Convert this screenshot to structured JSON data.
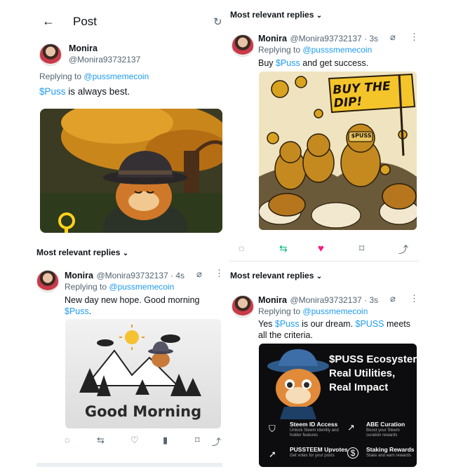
{
  "left_top": {
    "header_title": "Post",
    "name": "Monira",
    "handle": "@Monira93732137",
    "replying_prefix": "Replying to",
    "replying_to": "@pussmemecoin",
    "tweet_cashtag": "$Puss",
    "tweet_rest": " is always best."
  },
  "left_bottom": {
    "section_label": "Most relevant replies",
    "name": "Monira",
    "handle_time": "@Monira93732137 · 4s",
    "replying_prefix": "Replying to",
    "replying_to": "@pussmemecoin",
    "line1": "New day new hope. Good morning",
    "cashtag": "$Puss",
    "period": ".",
    "image_text": "Good Morning"
  },
  "right_top": {
    "section_label": "Most relevant replies",
    "name": "Monira",
    "handle_time": "@Monira93732137 · 3s",
    "replying_prefix": "Replying to",
    "replying_to": "@pusssmemecoin",
    "pre": "Buy ",
    "cashtag": "$Puss",
    "post": " and get success.",
    "image_banner": "BUY THE DIP!",
    "image_badge": "$PUSS"
  },
  "right_bottom": {
    "section_label": "Most relevant replies",
    "name": "Monira",
    "handle_time": "@Monira93732137 · 3s",
    "replying_prefix": "Replying to",
    "replying_to": "@pussmemecoin",
    "pre": "Yes ",
    "cashtag1": "$Puss",
    "mid": " is our dream. ",
    "cashtag2": "$PUSS",
    "post": " meets all the criteria.",
    "card_title1": "$PUSS Ecosyster",
    "card_title2": "Real Utilities,",
    "card_title3": "Real Impact",
    "feat1_title": "Steem ID Access",
    "feat1_sub": "Unlock Steem identity and holder features",
    "feat2_title": "ABE Curation",
    "feat2_sub": "Boost your Steem curation rewards",
    "feat3_title": "PUSSTEEM Upvotes",
    "feat3_sub": "Get votes for your posts",
    "feat4_title": "Staking Rewards",
    "feat4_sub": "Stake and earn rewards"
  },
  "colors": {
    "link": "#1d9bf0",
    "like": "#f91880",
    "retweet": "#00ba7c"
  }
}
